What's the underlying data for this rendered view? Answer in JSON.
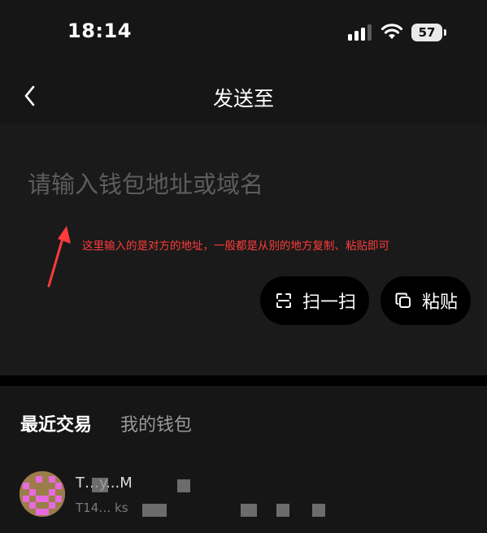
{
  "status_bar": {
    "time": "18:14",
    "battery": "57",
    "icons": [
      "signal-icon",
      "wifi-icon",
      "battery-icon"
    ]
  },
  "nav": {
    "back_icon": "chevron-left-icon",
    "title": "发送至"
  },
  "address_input": {
    "placeholder": "请输入钱包地址或域名",
    "value": ""
  },
  "annotation": {
    "text": "这里输入的是对方的地址，一般都是从别的地方复制、粘贴即可",
    "color": "#ff3b3b"
  },
  "actions": {
    "scan_label": "扫一扫",
    "scan_icon": "scan-icon",
    "paste_label": "粘贴",
    "paste_icon": "copy-icon"
  },
  "tabs": {
    "recent": "最近交易",
    "my_wallet": "我的钱包",
    "active": "recent"
  },
  "recent_transactions": [
    {
      "name": "T…y...M",
      "address": "T14… ks"
    }
  ],
  "colors": {
    "background": "#161616",
    "card": "#1a1a1a",
    "pill": "#000000",
    "placeholder": "#5d5d5d",
    "inactive_tab": "#9a9a9a"
  }
}
